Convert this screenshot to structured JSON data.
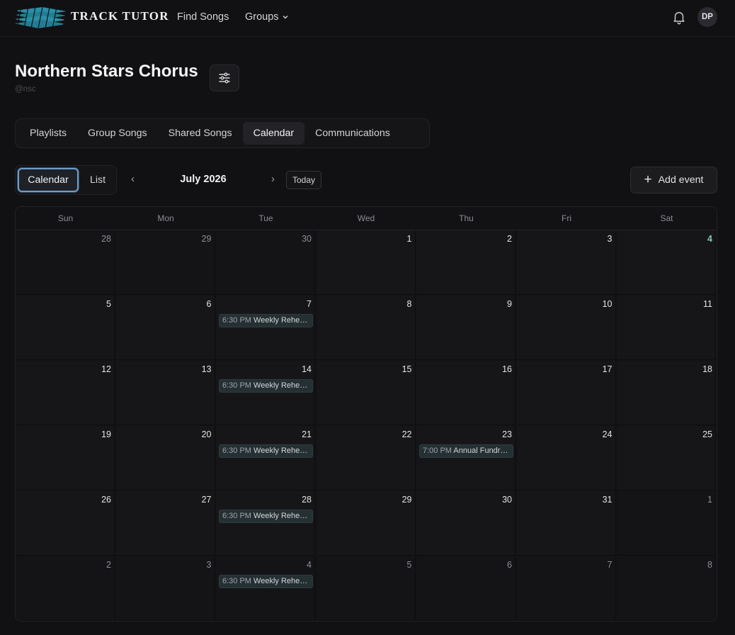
{
  "app": {
    "name": "TRACK TUTOR",
    "nav": {
      "find_songs": "Find Songs",
      "groups": "Groups"
    },
    "user_initials": "DP"
  },
  "group": {
    "title": "Northern Stars Chorus",
    "handle": "@nsc"
  },
  "tabs": [
    "Playlists",
    "Group Songs",
    "Shared Songs",
    "Calendar",
    "Communications"
  ],
  "active_tab": "Calendar",
  "calendar": {
    "view_toggle": {
      "calendar": "Calendar",
      "list": "List",
      "active": "Calendar"
    },
    "month_label": "July 2026",
    "prev": "‹",
    "next": "›",
    "today_button": "Today",
    "add_event_button": "Add event",
    "weekdays": [
      "Sun",
      "Mon",
      "Tue",
      "Wed",
      "Thu",
      "Fri",
      "Sat"
    ],
    "today_day": "4",
    "weeks": [
      [
        {
          "d": "28",
          "outside": true
        },
        {
          "d": "29",
          "outside": true
        },
        {
          "d": "30",
          "outside": true
        },
        {
          "d": "1"
        },
        {
          "d": "2"
        },
        {
          "d": "3"
        },
        {
          "d": "4",
          "today": true
        }
      ],
      [
        {
          "d": "5"
        },
        {
          "d": "6"
        },
        {
          "d": "7",
          "event": {
            "time": "6:30 PM",
            "title": "Weekly Rehearsal"
          }
        },
        {
          "d": "8"
        },
        {
          "d": "9"
        },
        {
          "d": "10"
        },
        {
          "d": "11"
        }
      ],
      [
        {
          "d": "12"
        },
        {
          "d": "13"
        },
        {
          "d": "14",
          "event": {
            "time": "6:30 PM",
            "title": "Weekly Rehearsal"
          }
        },
        {
          "d": "15"
        },
        {
          "d": "16"
        },
        {
          "d": "17"
        },
        {
          "d": "18"
        }
      ],
      [
        {
          "d": "19"
        },
        {
          "d": "20"
        },
        {
          "d": "21",
          "event": {
            "time": "6:30 PM",
            "title": "Weekly Rehearsal"
          }
        },
        {
          "d": "22"
        },
        {
          "d": "23",
          "event": {
            "time": "7:00 PM",
            "title": "Annual Fundraiser"
          }
        },
        {
          "d": "24"
        },
        {
          "d": "25"
        }
      ],
      [
        {
          "d": "26"
        },
        {
          "d": "27"
        },
        {
          "d": "28",
          "event": {
            "time": "6:30 PM",
            "title": "Weekly Rehearsal"
          }
        },
        {
          "d": "29"
        },
        {
          "d": "30"
        },
        {
          "d": "31"
        },
        {
          "d": "1",
          "outside": true
        }
      ],
      [
        {
          "d": "2",
          "outside": true
        },
        {
          "d": "3",
          "outside": true
        },
        {
          "d": "4",
          "outside": true,
          "event": {
            "time": "6:30 PM",
            "title": "Weekly Rehearsal"
          }
        },
        {
          "d": "5",
          "outside": true
        },
        {
          "d": "6",
          "outside": true
        },
        {
          "d": "7",
          "outside": true
        },
        {
          "d": "8",
          "outside": true
        }
      ]
    ]
  },
  "colors": {
    "background": "#111113",
    "accent_focus": "#6e9ec8",
    "today": "#86c9a6",
    "event_bg": "#253033",
    "logo": "#2a8fa6"
  },
  "icons": {
    "logo": "track-stripes-logo",
    "groups_dropdown": "chevron-down-icon",
    "notifications": "bell-icon",
    "settings": "sliders-icon",
    "add": "plus-icon"
  }
}
